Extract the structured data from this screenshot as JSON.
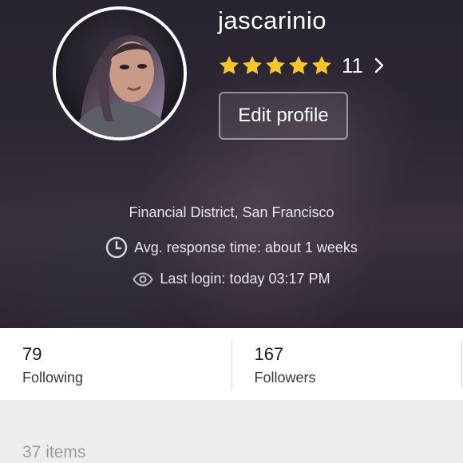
{
  "profile": {
    "username": "jascarinio",
    "rating_stars": 5,
    "rating_count": "11",
    "edit_button_label": "Edit profile",
    "location": "Financial District, San Francisco",
    "response_time": "Avg. response time: about 1 weeks",
    "last_login": "Last login: today 03:17 PM"
  },
  "stats": [
    {
      "value": "79",
      "label": "Following"
    },
    {
      "value": "167",
      "label": "Followers"
    }
  ],
  "items": {
    "count_label": "37 items"
  },
  "colors": {
    "star": "#f6c62b",
    "header_bg": "#2d2633",
    "text_white": "#ffffff",
    "muted_text": "#9a9aa0"
  },
  "icons": {
    "chevron": "chevron-right-icon",
    "clock": "clock-icon",
    "eye": "eye-icon",
    "star": "star-icon"
  }
}
